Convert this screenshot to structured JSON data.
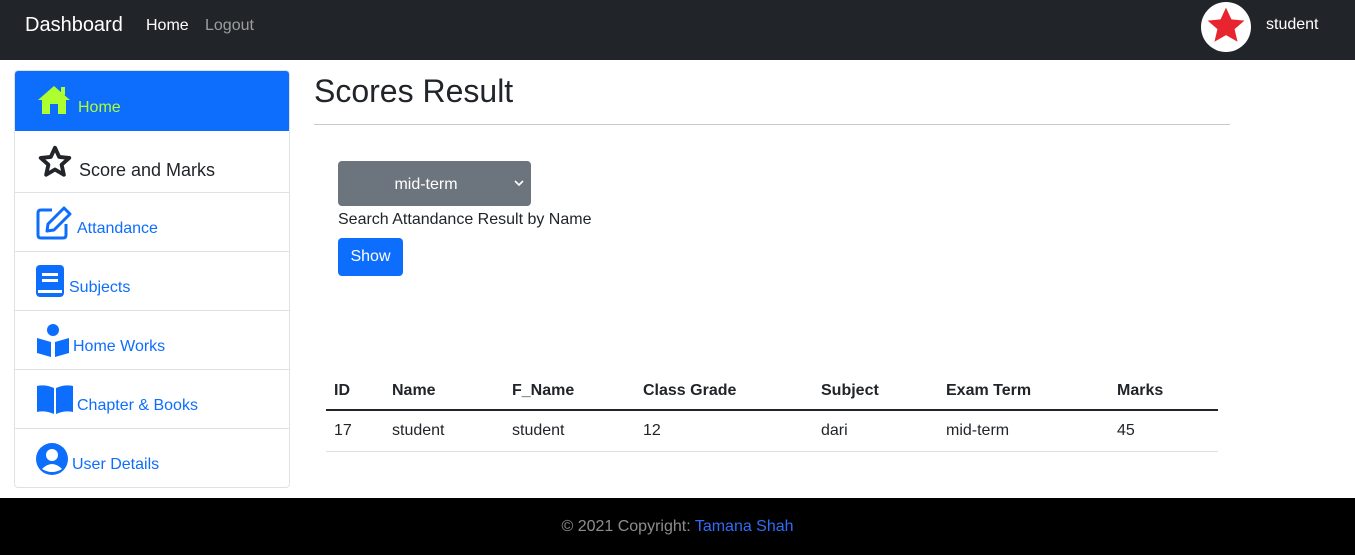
{
  "navbar": {
    "brand": "Dashboard",
    "links": {
      "home": "Home",
      "logout": "Logout"
    },
    "username": "student",
    "avatar_icon": "star-icon",
    "avatar_color": "#e8242f"
  },
  "sidebar": {
    "items": [
      {
        "label": "Home",
        "icon": "house-icon",
        "active": true
      },
      {
        "label": "Score and Marks",
        "icon": "star-icon"
      },
      {
        "label": "Attandance",
        "icon": "edit-icon"
      },
      {
        "label": "Subjects",
        "icon": "book-icon"
      },
      {
        "label": "Home Works",
        "icon": "reader-icon"
      },
      {
        "label": "Chapter & Books",
        "icon": "open-book-icon"
      },
      {
        "label": "User Details",
        "icon": "user-circle-icon"
      }
    ]
  },
  "main": {
    "title": "Scores Result",
    "filter": {
      "selected": "mid-term",
      "help": "Search Attandance Result by Name",
      "button": "Show"
    },
    "table": {
      "headers": [
        "ID",
        "Name",
        "F_Name",
        "Class Grade",
        "Subject",
        "Exam Term",
        "Marks"
      ],
      "rows": [
        [
          "17",
          "student",
          "student",
          "12",
          "dari",
          "mid-term",
          "45"
        ]
      ]
    }
  },
  "footer": {
    "prefix": "© 2021 Copyright: ",
    "owner": "Tamana Shah"
  },
  "colors": {
    "navbar": "#212529",
    "primary": "#0d6efd",
    "active_label": "#adff2f",
    "select": "#6c757d",
    "footer": "#000000"
  }
}
